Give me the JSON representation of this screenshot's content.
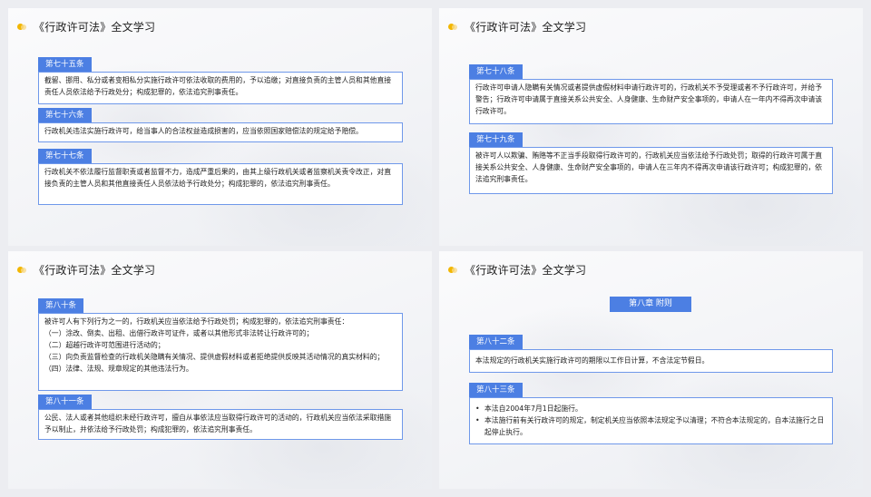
{
  "slides": [
    {
      "title": "《行政许可法》全文学习",
      "articles": [
        {
          "tag": "第七十五条",
          "text": "截留、挪用、私分或者变相私分实施行政许可依法收取的费用的，予以追缴；对直接负责的主管人员和其他直接责任人员依法给予行政处分；构成犯罪的，依法追究刑事责任。"
        },
        {
          "tag": "第七十六条",
          "text": "行政机关违法实施行政许可，给当事人的合法权益造成损害的，应当依照国家赔偿法的规定给予赔偿。"
        },
        {
          "tag": "第七十七条",
          "text": "行政机关不依法履行监督职责或者监督不力，造成严重后果的，由其上级行政机关或者监察机关责令改正，对直接负责的主管人员和其他直接责任人员依法给予行政处分；构成犯罪的，依法追究刑事责任。"
        }
      ]
    },
    {
      "title": "《行政许可法》全文学习",
      "articles": [
        {
          "tag": "第七十八条",
          "text": "行政许可申请人隐瞒有关情况或者提供虚假材料申请行政许可的，行政机关不予受理或者不予行政许可，并给予警告；行政许可申请属于直接关系公共安全、人身健康、生命财产安全事项的，申请人在一年内不得再次申请该行政许可。"
        },
        {
          "tag": "第七十九条",
          "text": "被许可人以欺骗、贿赂等不正当手段取得行政许可的，行政机关应当依法给予行政处罚；取得的行政许可属于直接关系公共安全、人身健康、生命财产安全事项的，申请人在三年内不得再次申请该行政许可；构成犯罪的，依法追究刑事责任。"
        }
      ]
    },
    {
      "title": "《行政许可法》全文学习",
      "articles": [
        {
          "tag": "第八十条",
          "lines": [
            "被许可人有下列行为之一的，行政机关应当依法给予行政处罚；构成犯罪的，依法追究刑事责任：",
            "（一）涂改、倒卖、出租、出借行政许可证件，或者以其他形式非法转让行政许可的；",
            "（二）超越行政许可范围进行活动的；",
            "（三）向负责监督检查的行政机关隐瞒有关情况、提供虚假材料或者拒绝提供反映其活动情况的真实材料的；",
            "（四）法律、法规、规章规定的其他违法行为。"
          ]
        },
        {
          "tag": "第八十一条",
          "text": "公民、法人或者其他组织未经行政许可，擅自从事依法应当取得行政许可的活动的，行政机关应当依法采取措施予以制止，并依法给予行政处罚；构成犯罪的，依法追究刑事责任。"
        }
      ]
    },
    {
      "title": "《行政许可法》全文学习",
      "chapter": "第八章  附则",
      "articles": [
        {
          "tag": "第八十二条",
          "text": "本法规定的行政机关实施行政许可的期限以工作日计算，不含法定节假日。"
        },
        {
          "tag": "第八十三条",
          "bullets": [
            "本法自2004年7月1日起施行。",
            "本法施行前有关行政许可的规定，制定机关应当依照本法规定予以清理；不符合本法规定的，自本法施行之日起停止执行。"
          ]
        }
      ]
    }
  ]
}
